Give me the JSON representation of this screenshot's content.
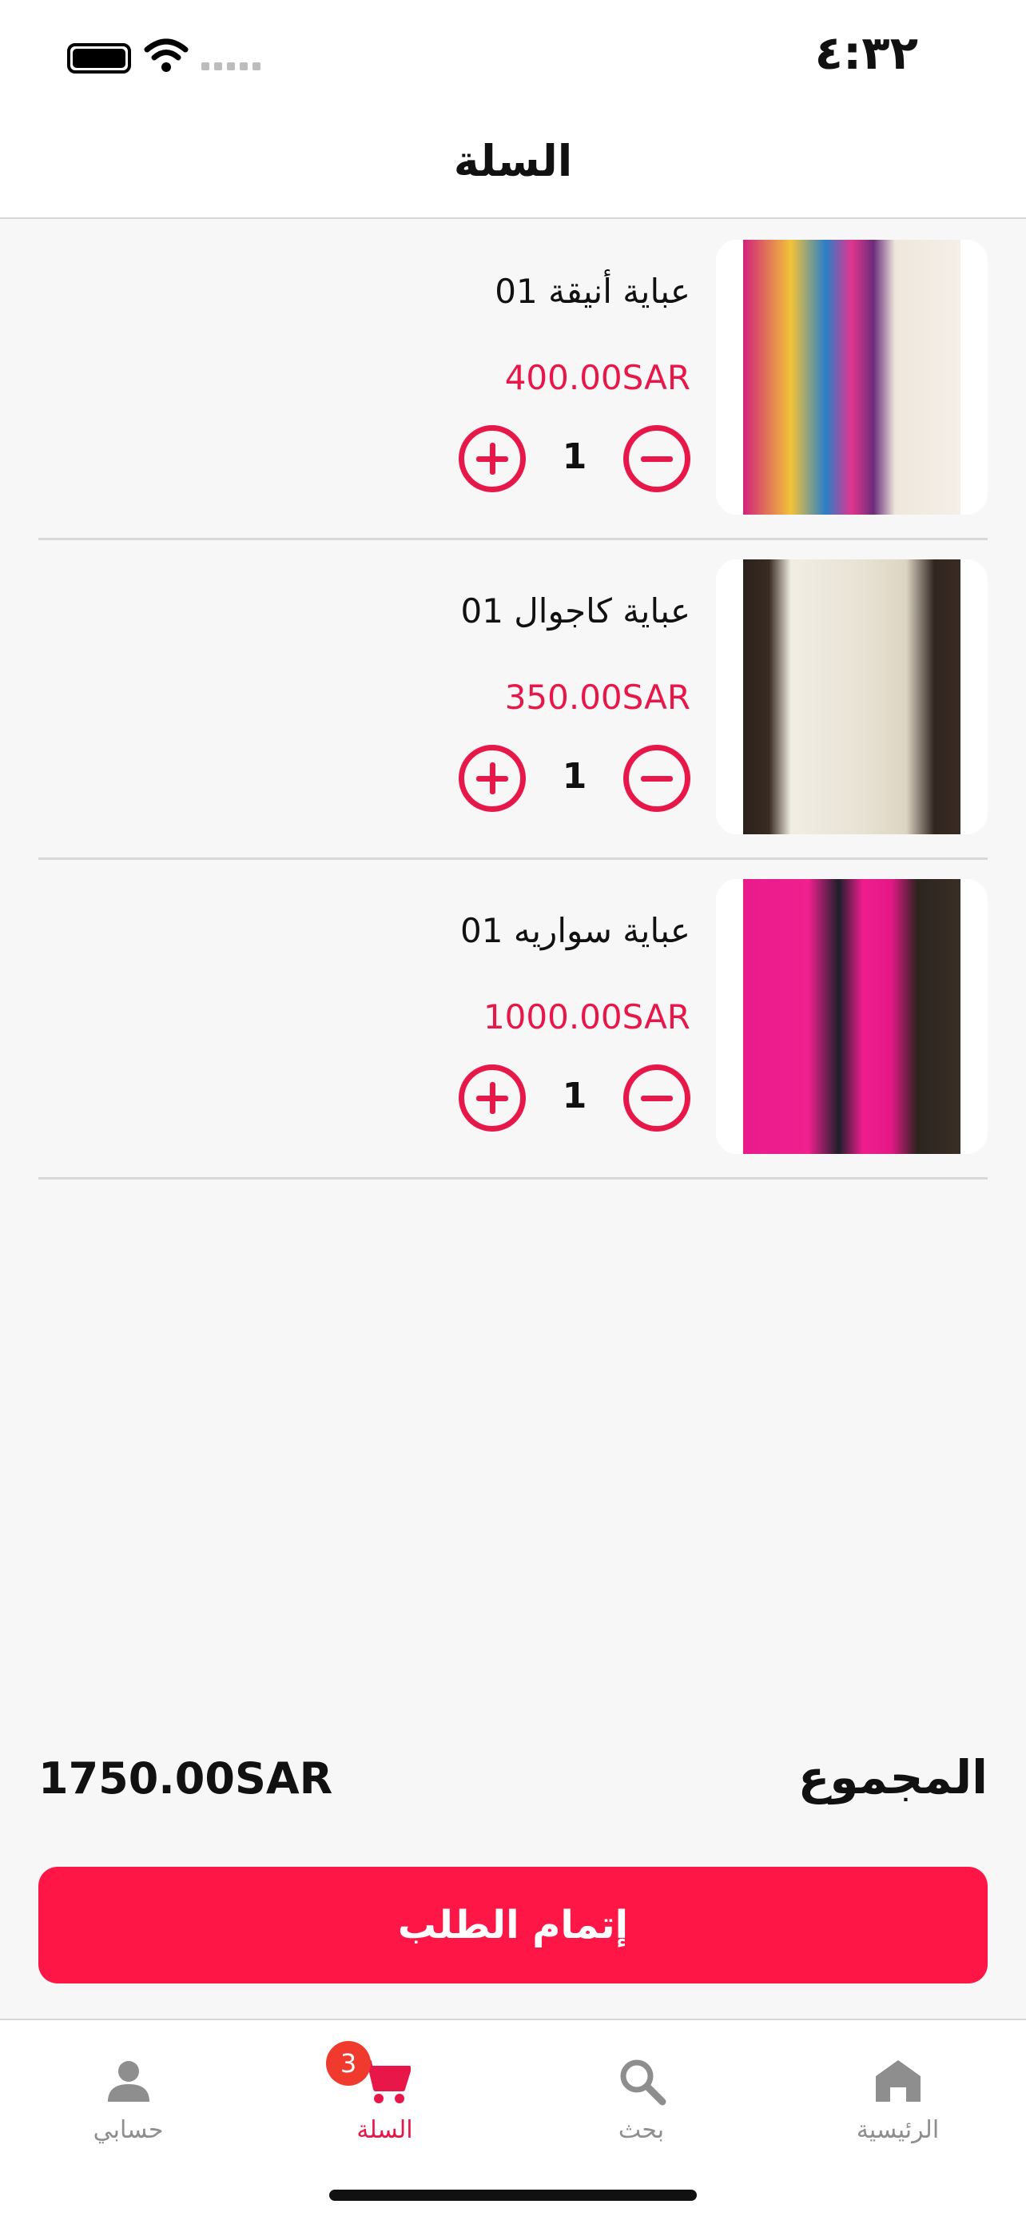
{
  "status_bar": {
    "time": "٤:٣٢"
  },
  "header": {
    "title": "السلة"
  },
  "cart": {
    "items": [
      {
        "name": "عباية أنيقة 01",
        "price": "400.00SAR",
        "quantity": "1"
      },
      {
        "name": "عباية كاجوال 01",
        "price": "350.00SAR",
        "quantity": "1"
      },
      {
        "name": "عباية سواريه 01",
        "price": "1000.00SAR",
        "quantity": "1"
      }
    ],
    "total_label": "المجموع",
    "total_amount": "1750.00SAR",
    "checkout_label": "إتمام الطلب"
  },
  "tabbar": {
    "badge_count": "3",
    "tabs": [
      {
        "label": "الرئيسية",
        "icon": "home-icon",
        "active": false
      },
      {
        "label": "بحث",
        "icon": "search-icon",
        "active": false
      },
      {
        "label": "السلة",
        "icon": "cart-icon",
        "active": true
      },
      {
        "label": "حسابي",
        "icon": "user-icon",
        "active": false
      }
    ]
  },
  "colors": {
    "accent": "#e8174a",
    "button": "#fe1746",
    "badge": "#f03a2e",
    "inactive": "#8e8e8e"
  }
}
